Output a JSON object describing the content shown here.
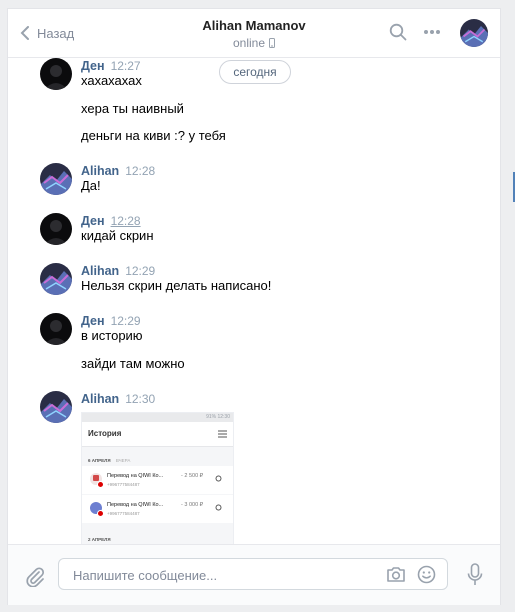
{
  "header": {
    "back_label": "Назад",
    "contact_name": "Alihan Mamanov",
    "status": "online",
    "icons": [
      "chevron-left-icon",
      "search-icon",
      "more-icon",
      "mobile-icon"
    ]
  },
  "date_separator": "сегодня",
  "messages": [
    {
      "author": "Ден",
      "time": "12:27",
      "lines": [
        "хахахахах",
        "хера ты наивный",
        "деньги на киви :? у тебя"
      ]
    },
    {
      "author": "Alihan",
      "time": "12:28",
      "lines": [
        "Да!"
      ]
    },
    {
      "author": "Ден",
      "time": "12:28",
      "lines": [
        "кидай скрин"
      ]
    },
    {
      "author": "Alihan",
      "time": "12:29",
      "lines": [
        "Нельзя скрин делать написано!"
      ]
    },
    {
      "author": "Ден",
      "time": "12:29",
      "lines": [
        "в историю",
        "зайди там можно"
      ]
    },
    {
      "author": "Alihan",
      "time": "12:30",
      "lines": []
    }
  ],
  "attachment": {
    "status_bar": "91% 12:30",
    "title": "История",
    "date_group_1": "6 АПРЕЛЯ",
    "date_group_1_sub": "ВЧЕРА",
    "transactions": [
      {
        "name": "Перевод на QIWI Ко...",
        "amount": "- 2 500 ₽",
        "account": "+996777584487"
      },
      {
        "name": "Перевод на QIWI Ко...",
        "amount": "- 3 000 ₽",
        "account": "+996777584487"
      }
    ],
    "date_group_2": "2 АПРЕЛЯ"
  },
  "composer": {
    "placeholder": "Напишите сообщение..."
  },
  "colors": {
    "accent": "#5181b8",
    "author": "#42648b",
    "time": "#93a3b3",
    "muted": "#828a99"
  }
}
